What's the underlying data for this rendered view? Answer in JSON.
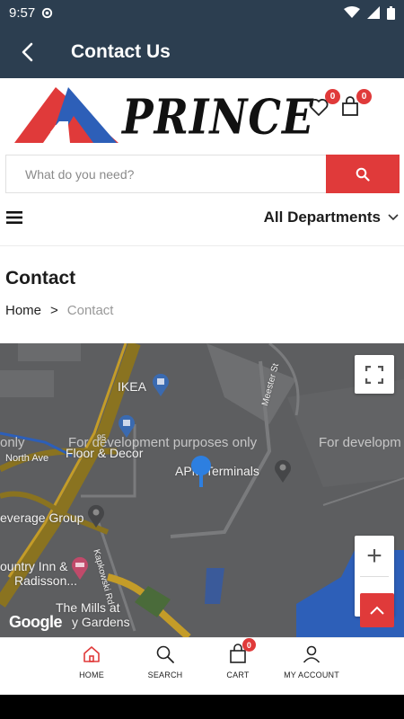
{
  "status_bar": {
    "time": "9:57"
  },
  "app_bar": {
    "title": "Contact Us"
  },
  "brand": {
    "name": "PRINCE",
    "colors": {
      "red": "#e03a3a",
      "blue": "#2d5fb8",
      "navy": "#2c3e50"
    }
  },
  "header_icons": {
    "wishlist_count": "0",
    "cart_count": "0"
  },
  "search": {
    "placeholder": "What do you need?"
  },
  "departments": {
    "label": "All Departments"
  },
  "page": {
    "title": "Contact",
    "breadcrumb": [
      "Home",
      ">",
      "Contact"
    ]
  },
  "map": {
    "labels": [
      "IKEA",
      "Floor & Decor",
      "APM Terminals",
      "North Ave",
      "Kapkowski Rd",
      "Meester St",
      "everage Group",
      "ountry Inn &",
      "Radisson...",
      "The Mills at",
      "y Gardens",
      "95"
    ],
    "watermark": [
      "For development purposes only",
      "For developm",
      "only"
    ],
    "google_logo": "Google",
    "zoom_in": "+",
    "zoom_out": "−"
  },
  "bottom_nav": {
    "items": [
      {
        "label": "HOME",
        "icon": "home-icon"
      },
      {
        "label": "SEARCH",
        "icon": "search-icon"
      },
      {
        "label": "CART",
        "icon": "cart-icon",
        "badge": "0"
      },
      {
        "label": "MY ACCOUNT",
        "icon": "user-icon"
      }
    ]
  }
}
